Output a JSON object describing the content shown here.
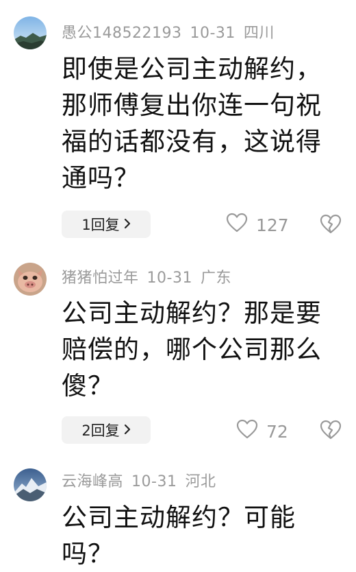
{
  "comments": [
    {
      "username": "愚公148522193",
      "date": "10-31",
      "location": "四川",
      "text": "即使是公司主动解约，那师傅复出你连一句祝福的话都没有，这说得通吗？",
      "reply_label": "1回复",
      "likes": "127"
    },
    {
      "username": "猪猪怕过年",
      "date": "10-31",
      "location": "广东",
      "text": "公司主动解约？那是要赔偿的，哪个公司那么傻？",
      "reply_label": "2回复",
      "likes": "72"
    },
    {
      "username": "云海峰高",
      "date": "10-31",
      "location": "河北",
      "text": "公司主动解约？可能吗？"
    }
  ],
  "icons": {
    "like": "heart-outline-icon",
    "dislike": "broken-heart-icon",
    "reply_chevron": "chevron-right-icon"
  },
  "colors": {
    "meta_text": "#9a9a9a",
    "body_text": "#111111",
    "reply_bg": "#f2f2f2",
    "icon": "#999999"
  }
}
